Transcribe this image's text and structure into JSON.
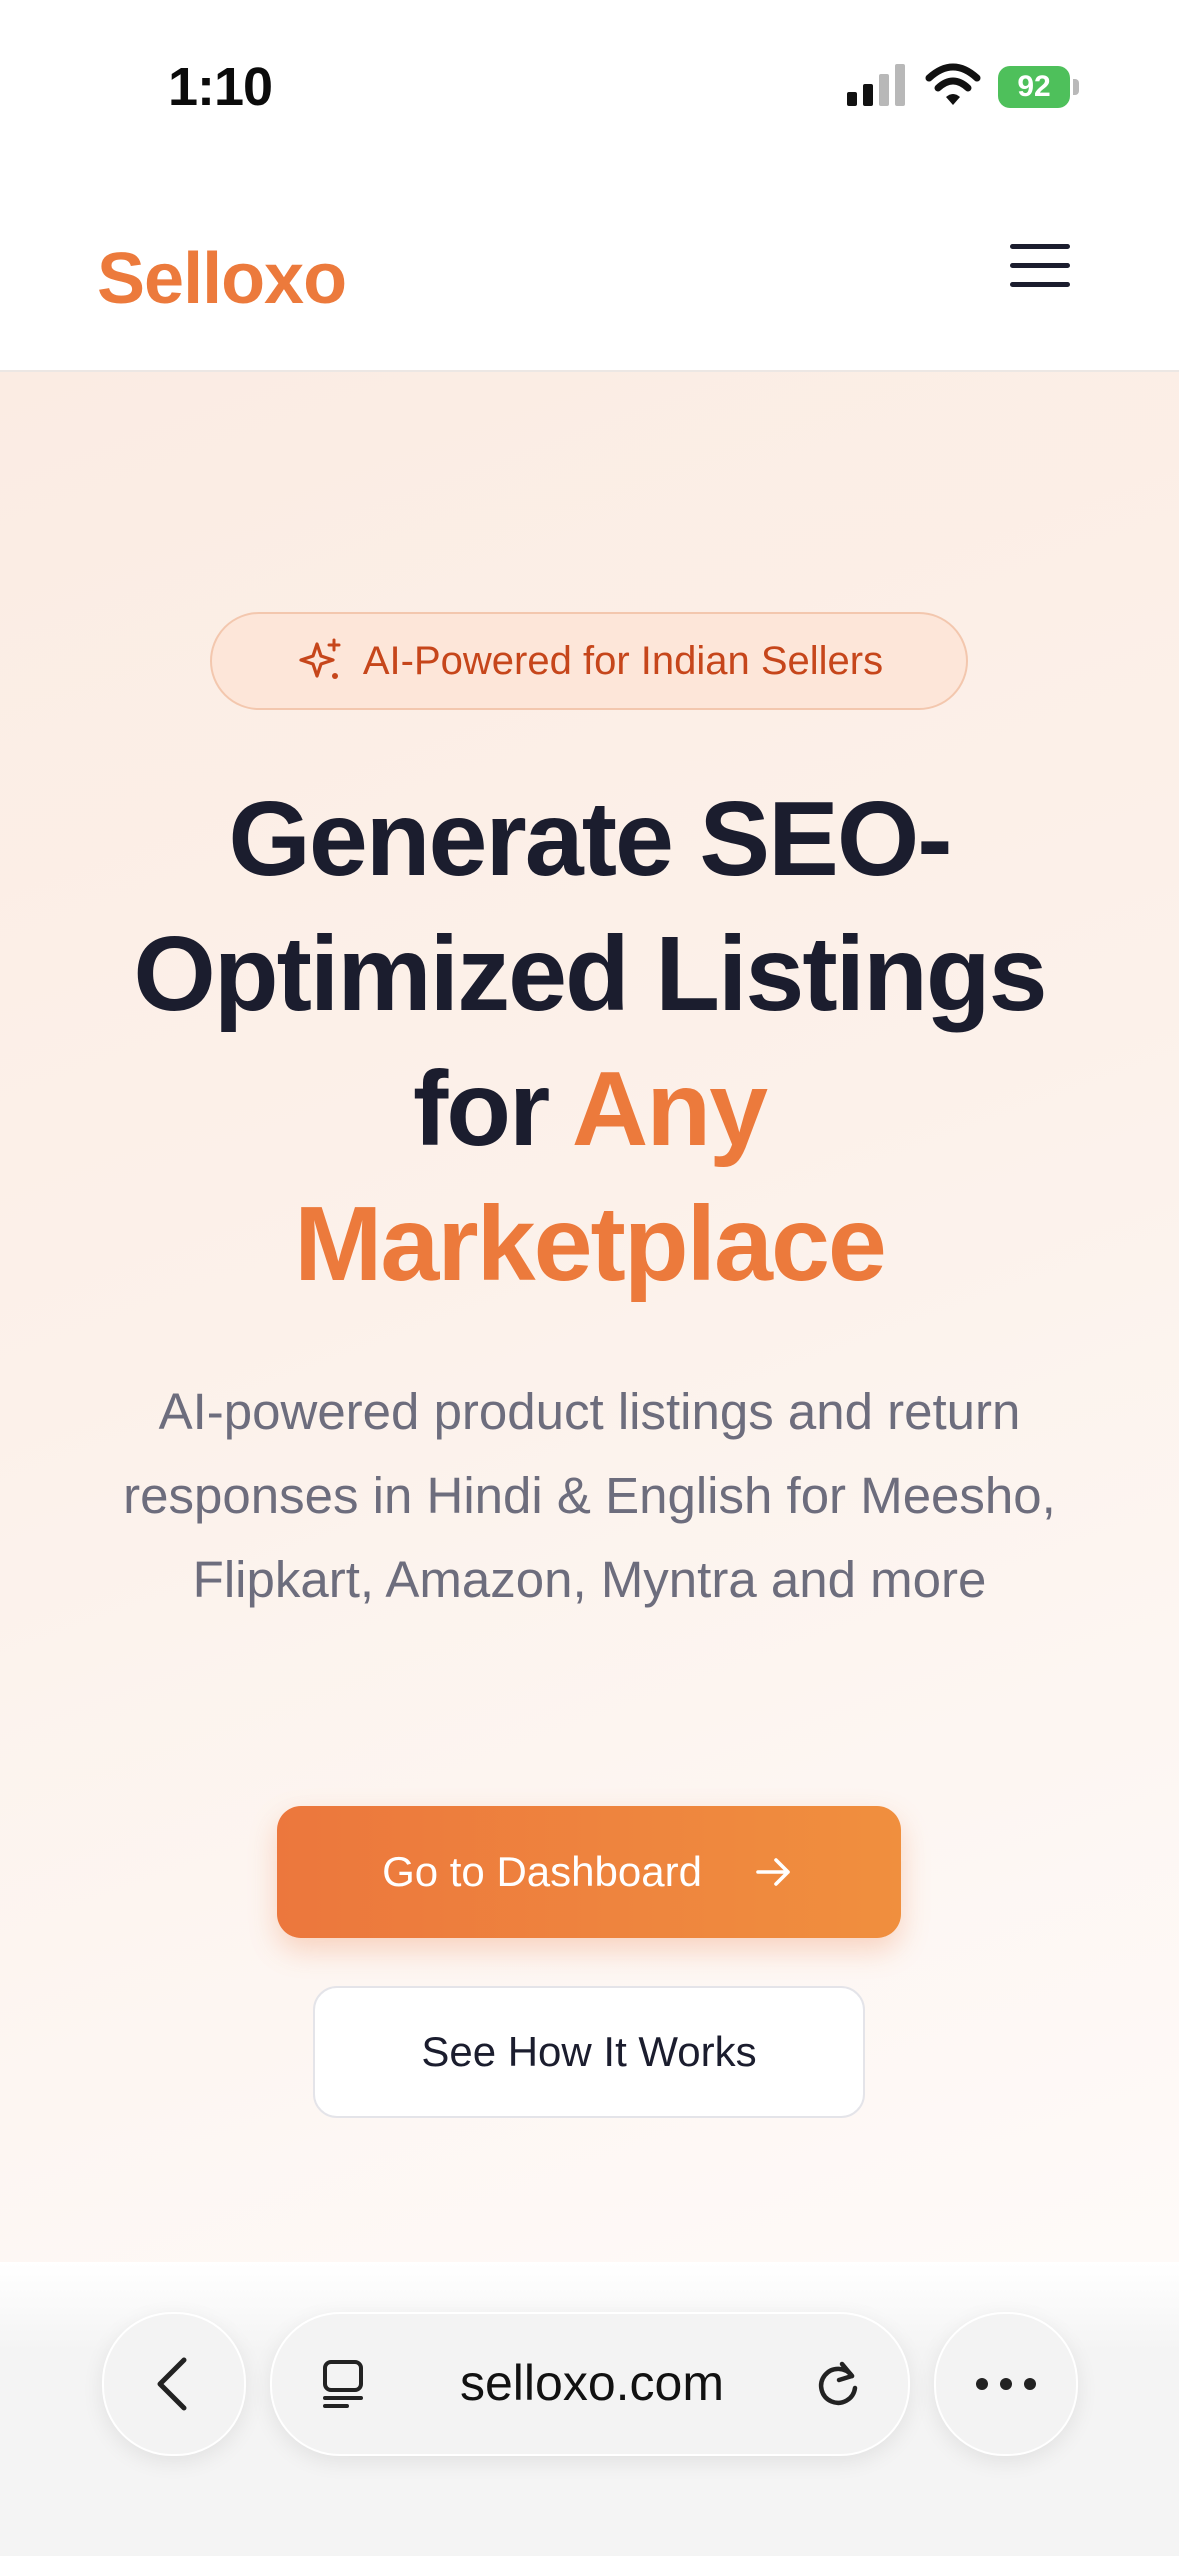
{
  "status_bar": {
    "time": "1:10",
    "battery": "92"
  },
  "header": {
    "logo": "Selloxo",
    "menu_icon": "hamburger-menu-icon"
  },
  "hero": {
    "badge": "AI-Powered for Indian Sellers",
    "title_line1": "Generate SEO-",
    "title_line2": "Optimized Listings",
    "title_line3_plain": "for ",
    "title_line3_accent": "Any",
    "title_line4_accent": "Marketplace",
    "subtitle": "AI-powered product listings and return responses in Hindi & English for Meesho, Flipkart, Amazon, Myntra and more",
    "primary_cta": "Go to Dashboard",
    "secondary_cta": "See How It Works"
  },
  "browser": {
    "url": "selloxo.com"
  },
  "colors": {
    "accent": "#ec7a3c",
    "text_dark": "#1b1d2e",
    "badge_text": "#c6461b",
    "muted": "#6d6d7d"
  }
}
